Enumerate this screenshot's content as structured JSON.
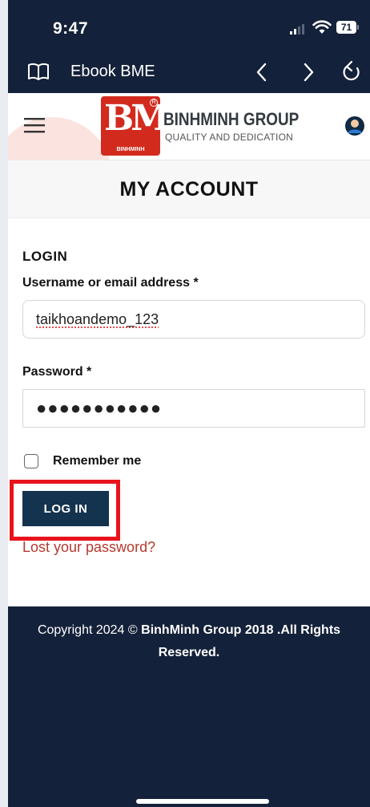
{
  "status_bar": {
    "time": "9:47",
    "battery": "71",
    "signal_icon": "cellular-signal-icon",
    "wifi_icon": "wifi-icon",
    "battery_icon": "battery-icon"
  },
  "browser": {
    "title": "Ebook BME",
    "book_icon": "book-icon",
    "back_icon": "chevron-left-icon",
    "forward_icon": "chevron-right-icon",
    "reload_icon": "reload-icon"
  },
  "header": {
    "brand_name": "BINHMINH GROUP",
    "tagline": "QUALITY AND DEDICATION",
    "logo_text": "BM",
    "logo_subtext": "BINHMINH",
    "menu_icon": "hamburger-menu-icon",
    "account_icon": "user-account-icon"
  },
  "page": {
    "title": "MY ACCOUNT"
  },
  "login": {
    "heading": "LOGIN",
    "username_label": "Username or email address *",
    "username_value": "taikhoandemo_123",
    "password_label": "Password *",
    "password_value": "●●●●●●●●●●●",
    "remember_label": "Remember me",
    "remember_checked": false,
    "submit_label": "LOG IN",
    "lost_password": "Lost your password?"
  },
  "footer": {
    "copyright_prefix": "Copyright 2024 © ",
    "copyright_bold": "BinhMinh Group 2018 .All Rights Reserved."
  },
  "colors": {
    "dark_navy": "#14213a",
    "button": "#14334e",
    "brand_red": "#d22b1e",
    "link": "#b53a2e",
    "highlight": "#e8141d"
  }
}
